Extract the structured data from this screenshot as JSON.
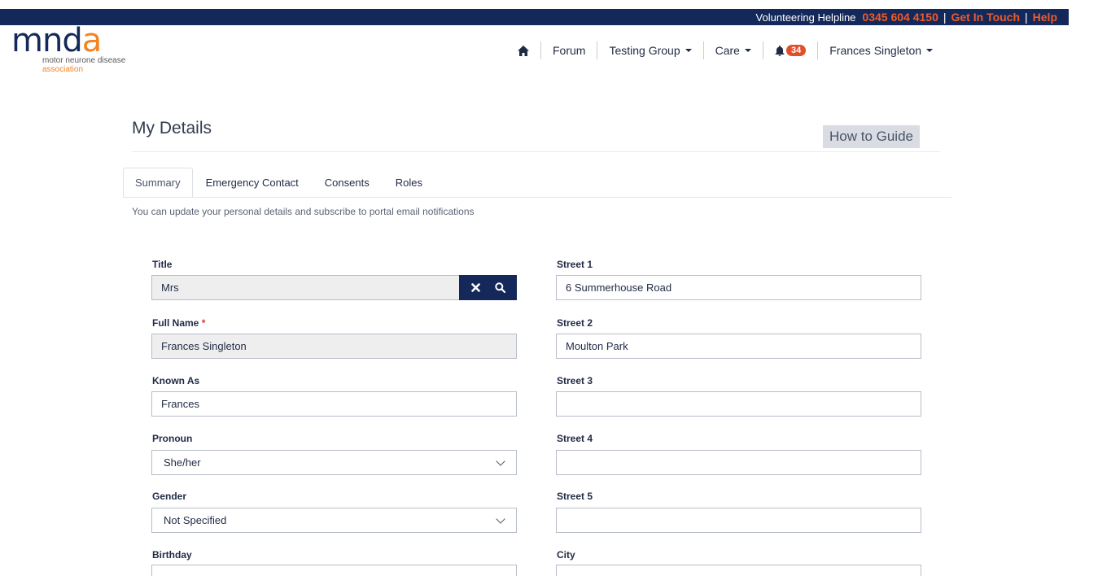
{
  "topbar": {
    "helpline_label": "Volunteering Helpline",
    "phone": "0345 604 4150",
    "separator": "|",
    "get_in_touch": "Get In Touch",
    "help": "Help"
  },
  "logo": {
    "word_m": "mn",
    "word_d": "d",
    "word_a": "a",
    "sub1": "motor neurone disease",
    "sub2": "association"
  },
  "nav": {
    "home_icon": "home-icon",
    "forum": "Forum",
    "testing_group": "Testing Group",
    "care": "Care",
    "bell_icon": "bell-icon",
    "notification_count": "34",
    "user_name": "Frances Singleton"
  },
  "page": {
    "title": "My Details",
    "how_to_guide": "How to Guide",
    "intro": "You can update your personal details and subscribe to portal email notifications"
  },
  "tabs": [
    {
      "label": "Summary",
      "active": true
    },
    {
      "label": "Emergency Contact",
      "active": false
    },
    {
      "label": "Consents",
      "active": false
    },
    {
      "label": "Roles",
      "active": false
    }
  ],
  "form": {
    "left": {
      "title": {
        "label": "Title",
        "value": "Mrs"
      },
      "full_name": {
        "label": "Full Name",
        "required_mark": "*",
        "value": "Frances Singleton"
      },
      "known_as": {
        "label": "Known As",
        "value": "Frances"
      },
      "pronoun": {
        "label": "Pronoun",
        "value": "She/her"
      },
      "gender": {
        "label": "Gender",
        "value": "Not Specified"
      },
      "birthday": {
        "label": "Birthday",
        "value": ""
      }
    },
    "right": {
      "street1": {
        "label": "Street 1",
        "value": "6 Summerhouse Road"
      },
      "street2": {
        "label": "Street 2",
        "value": "Moulton Park"
      },
      "street3": {
        "label": "Street 3",
        "value": ""
      },
      "street4": {
        "label": "Street 4",
        "value": ""
      },
      "street5": {
        "label": "Street 5",
        "value": ""
      },
      "city": {
        "label": "City",
        "value": ""
      }
    }
  },
  "colors": {
    "navy": "#14295a",
    "orange": "#f05a28",
    "badge": "#e04e2b"
  }
}
